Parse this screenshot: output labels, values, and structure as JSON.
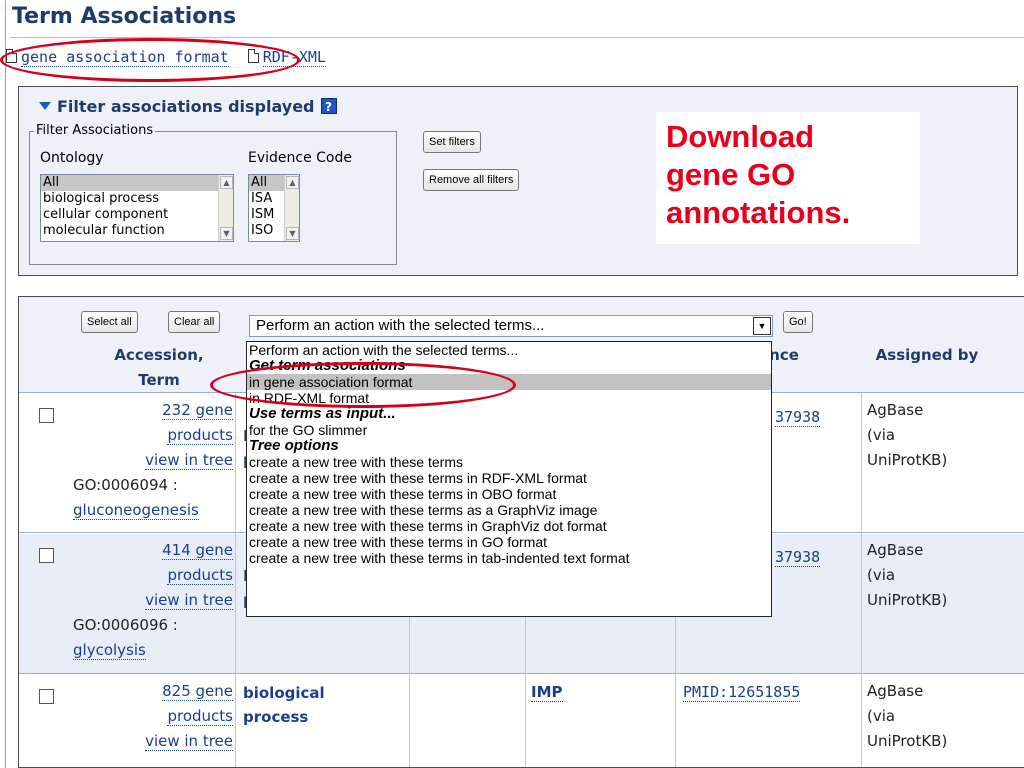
{
  "page": {
    "title": "Term Associations"
  },
  "formats": [
    {
      "label": "gene association format"
    },
    {
      "label": "RDF-XML"
    }
  ],
  "filter": {
    "heading": "Filter associations displayed",
    "help_glyph": "?",
    "legend": "Filter Associations",
    "ontology_label": "Ontology",
    "ontology_options": [
      "All",
      "biological process",
      "cellular component",
      "molecular function"
    ],
    "ontology_selected": "All",
    "evidence_label": "Evidence Code",
    "evidence_options": [
      "All",
      "ISA",
      "ISM",
      "ISO"
    ],
    "evidence_selected": "All",
    "set_filters": "Set filters",
    "remove_filters": "Remove all filters"
  },
  "callout": {
    "lines": [
      "Download",
      "gene GO",
      "annotations."
    ]
  },
  "actions": {
    "select_all": "Select all",
    "clear_all": "Clear all",
    "select_value": "Perform an action with the selected terms...",
    "go": "Go!"
  },
  "table": {
    "headers": {
      "accession_1": "Accession,",
      "accession_2": "Term",
      "evidence_partial": "ence",
      "assigned_by": "Assigned by"
    },
    "rows": [
      {
        "count": "232 gene",
        "products": "products",
        "tree": "view in tree",
        "go_id": "GO:0006094 :",
        "go_term": "gluconeogenesis",
        "term_partial_1": "I",
        "term_partial_2": "p",
        "evidence": "",
        "reference_partial": "37938",
        "by_1": "AgBase",
        "by_2": "(via",
        "by_3": "UniProtKB)"
      },
      {
        "count": "414 gene",
        "products": "products",
        "tree": "view in tree",
        "go_id": "GO:0006096 :",
        "go_term": "glycolysis",
        "term_partial_1": "I",
        "term_partial_2": "p",
        "evidence": "",
        "reference_partial": "37938",
        "by_1": "AgBase",
        "by_2": "(via",
        "by_3": "UniProtKB)"
      },
      {
        "count": "825 gene",
        "products": "products",
        "tree": "view in tree",
        "go_id": "",
        "go_term": "",
        "term_partial_1": "biological",
        "term_partial_2": "process",
        "evidence": "IMP",
        "reference_partial": "PMID:12651855",
        "by_1": "AgBase",
        "by_2": "(via",
        "by_3": "UniProtKB)"
      }
    ]
  },
  "dropdown": {
    "items": [
      {
        "label": "Perform an action with the selected terms...",
        "kind": "item"
      },
      {
        "label": "Get term associations",
        "kind": "group"
      },
      {
        "label": "in gene association format",
        "kind": "highlighted"
      },
      {
        "label": "in RDF-XML format",
        "kind": "item"
      },
      {
        "label": "Use terms as input...",
        "kind": "group"
      },
      {
        "label": "for the GO slimmer",
        "kind": "item"
      },
      {
        "label": "Tree options",
        "kind": "group"
      },
      {
        "label": "create a new tree with these terms",
        "kind": "item"
      },
      {
        "label": "create a new tree with these terms in RDF-XML format",
        "kind": "item"
      },
      {
        "label": "create a new tree with these terms in OBO format",
        "kind": "item"
      },
      {
        "label": "create a new tree with these terms as a GraphViz image",
        "kind": "item"
      },
      {
        "label": "create a new tree with these terms in GraphViz dot format",
        "kind": "item"
      },
      {
        "label": "create a new tree with these terms in GO format",
        "kind": "item"
      },
      {
        "label": "create a new tree with these terms in tab-indented text format",
        "kind": "item"
      }
    ]
  },
  "colors": {
    "annotation_red": "#d6001c",
    "heading_blue": "#1d3b6b",
    "link_blue": "#1a3f8f",
    "panel_bg": "#eef2f8"
  }
}
